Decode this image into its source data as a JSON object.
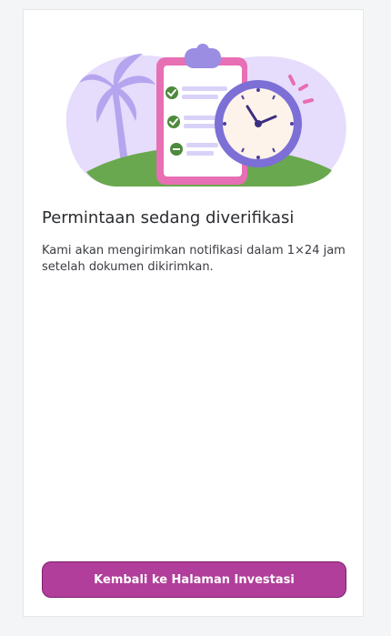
{
  "status": {
    "title": "Permintaan sedang diverifikasi",
    "description": "Kami akan mengirimkan notifikasi dalam 1×24 jam setelah dokumen dikirimkan."
  },
  "actions": {
    "back_label": "Kembali ke Halaman Investasi"
  },
  "colors": {
    "page_background": "#f4f5f6",
    "card_background": "#ffffff",
    "primary_button": "#b13e9a",
    "primary_button_border": "#7d1e6e",
    "blob": "#e6dcfb",
    "grass": "#6aa84f",
    "clipboard": "#e76fb4",
    "clock_ring": "#7c6fd6"
  },
  "illustration": {
    "icons": [
      "palm-tree-icon",
      "clipboard-checklist-icon",
      "clock-icon"
    ]
  }
}
